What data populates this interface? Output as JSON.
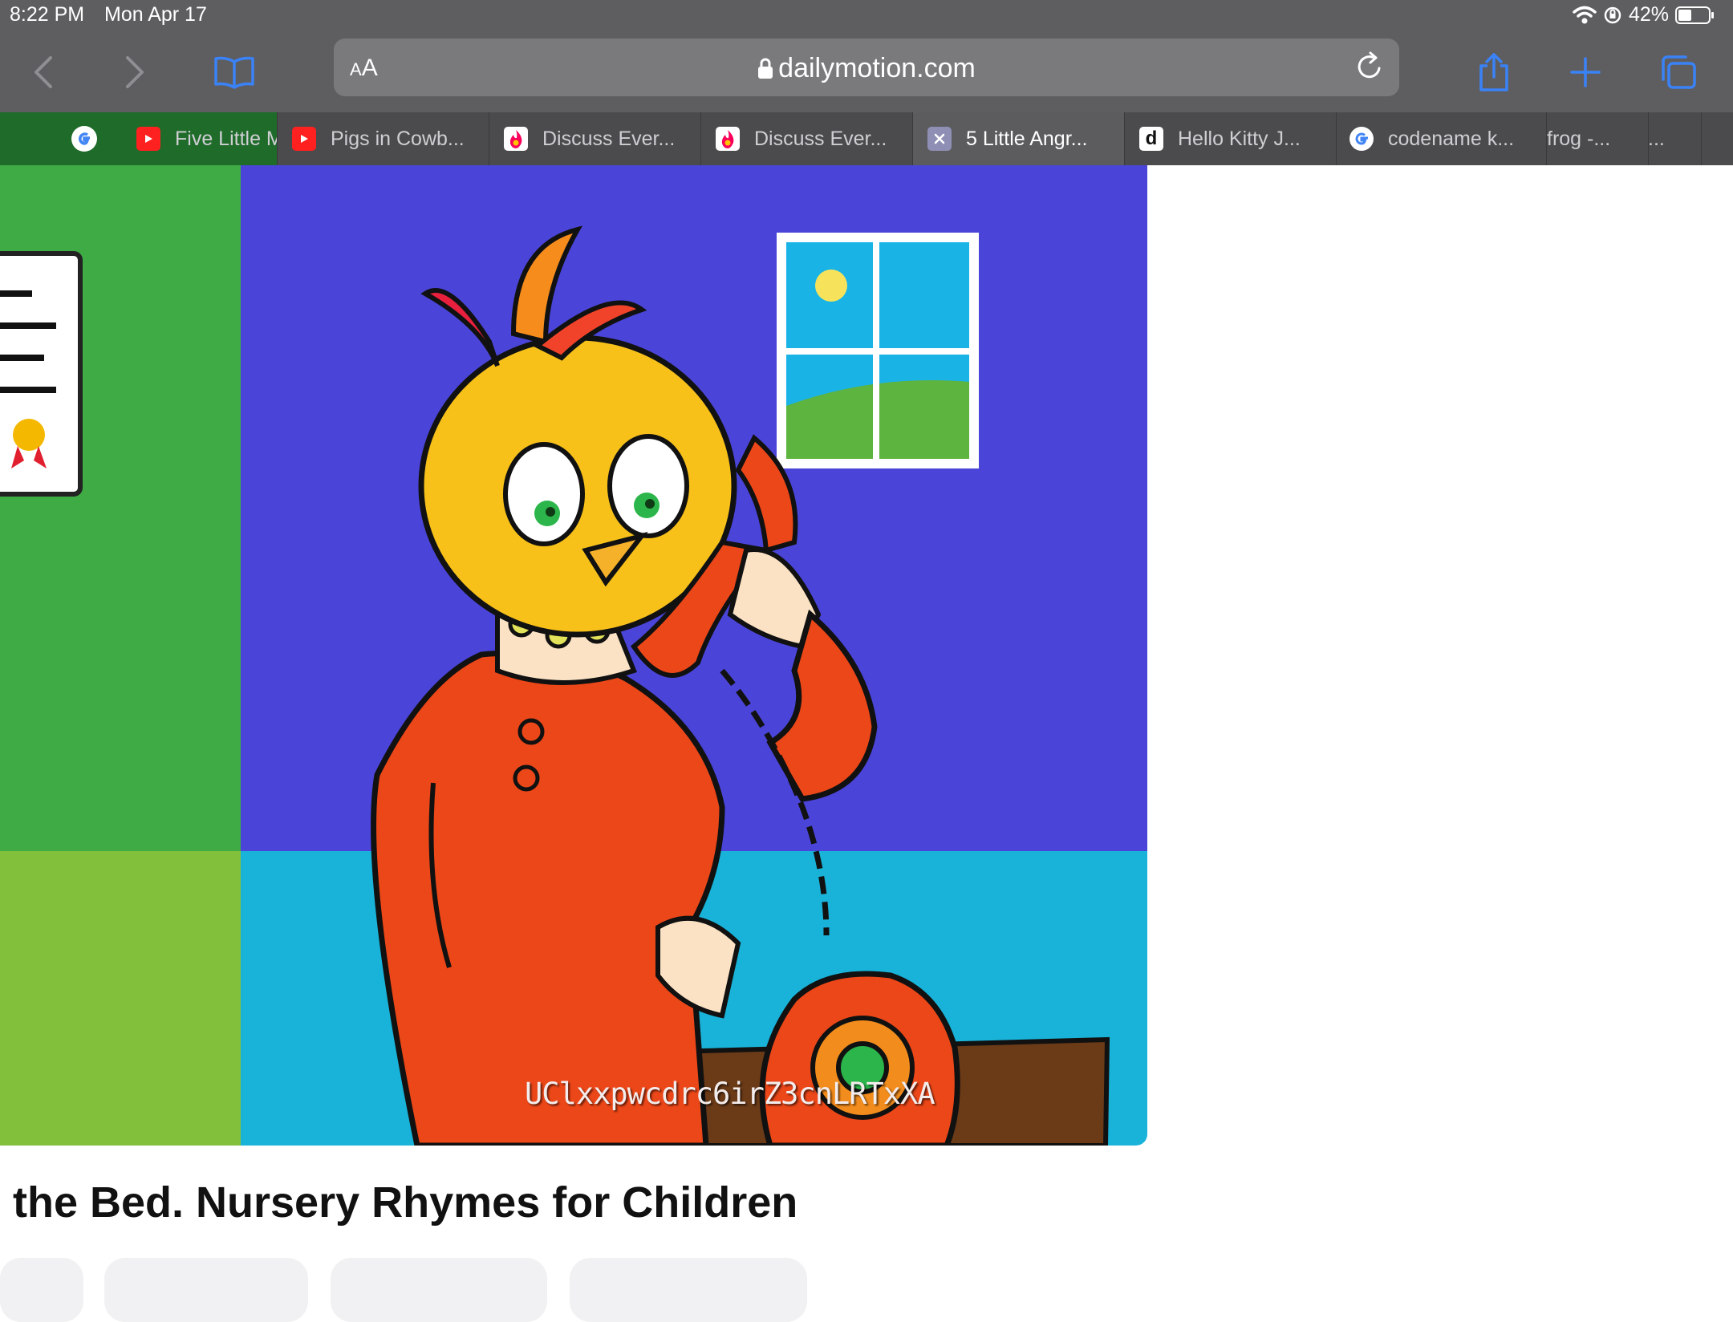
{
  "status_bar": {
    "time": "8:22 PM",
    "date": "Mon Apr 17",
    "battery": "42%"
  },
  "toolbar": {
    "back_icon": "chevron-left-icon",
    "forward_icon": "chevron-right-icon",
    "bookmarks_icon": "book-icon",
    "reader_label": "AA",
    "url": "dailymotion.com",
    "share_icon": "share-icon",
    "new_tab_icon": "plus-icon",
    "tabs_icon": "tabs-overview-icon"
  },
  "tabs": [
    {
      "label": "Five Little M",
      "favicon": "youtube-icon"
    },
    {
      "label": "Pigs in Cowb...",
      "favicon": "youtube-icon"
    },
    {
      "label": "Discuss Ever...",
      "favicon": "fandom-icon"
    },
    {
      "label": "Discuss Ever...",
      "favicon": "fandom-icon"
    },
    {
      "label": "5 Little Angr...",
      "favicon": "close-tab-icon",
      "active": true
    },
    {
      "label": "Hello Kitty J...",
      "favicon": "dailymotion-icon"
    },
    {
      "label": "codename k...",
      "favicon": "google-icon"
    },
    {
      "label": "frog -...",
      "favicon": ""
    },
    {
      "label": "...",
      "favicon": ""
    }
  ],
  "video": {
    "watermark": "UClxxpwcdrc6irZ3cnLRTxXA"
  },
  "page": {
    "title": "the Bed. Nursery Rhymes for Children"
  },
  "colors": {
    "chrome": "#5e5e60",
    "accent": "#3a82f7",
    "tab_bar": "#4b4b4d"
  }
}
